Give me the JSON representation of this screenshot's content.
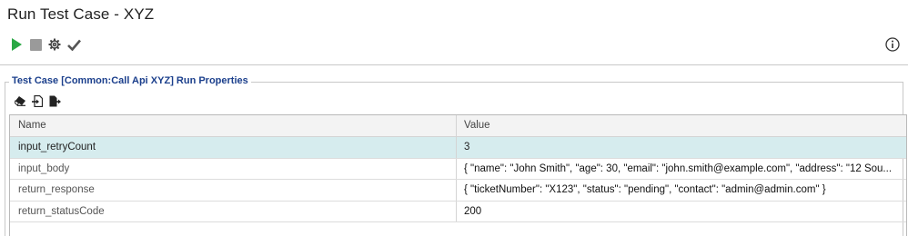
{
  "window": {
    "title": "Run Test Case - XYZ"
  },
  "toolbar": {
    "buttons": [
      {
        "icon": "play-icon",
        "color": "#2aa845"
      },
      {
        "icon": "stop-icon",
        "color": "#9a9a9a"
      },
      {
        "icon": "gear-icon",
        "color": "#444444"
      },
      {
        "icon": "check-icon",
        "color": "#555555"
      }
    ],
    "info_icon": "info-icon"
  },
  "properties": {
    "legend": "Test Case [Common:Call Api XYZ] Run Properties",
    "legend_color": "#1b3f8c",
    "toolbar_icons": [
      "eraser-icon",
      "import-icon",
      "export-icon"
    ],
    "columns": {
      "name": "Name",
      "value": "Value"
    },
    "rows": [
      {
        "name": "input_retryCount",
        "value": "3",
        "selected": true
      },
      {
        "name": "input_body",
        "value": "{ \"name\": \"John Smith\", \"age\": 30, \"email\": \"john.smith@example.com\", \"address\": \"12 Sou..."
      },
      {
        "name": "return_response",
        "value": "{ \"ticketNumber\": \"X123\", \"status\": \"pending\", \"contact\": \"admin@admin.com\" }"
      },
      {
        "name": "return_statusCode",
        "value": "200"
      }
    ],
    "selected_row_color": "#d6ecee"
  }
}
